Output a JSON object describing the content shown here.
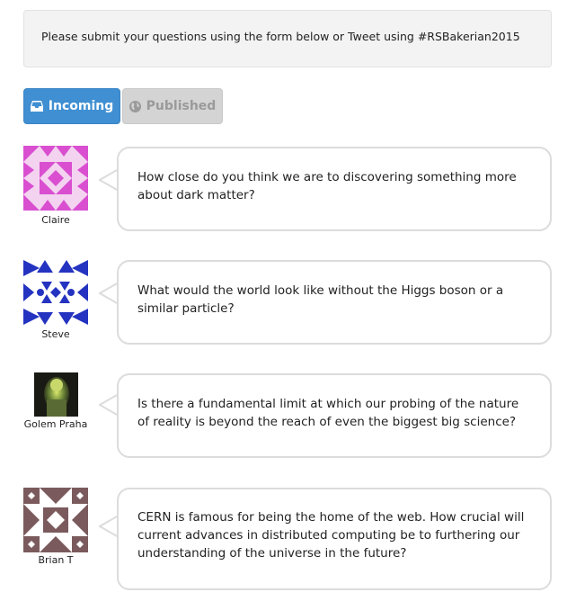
{
  "notice": {
    "text": "Please submit your questions using the form below or Tweet using #RSBakerian2015"
  },
  "tabs": [
    {
      "label": "Incoming",
      "icon": "inbox-icon",
      "active": true,
      "color": "#3f8fd2"
    },
    {
      "label": "Published",
      "icon": "globe-icon",
      "active": false,
      "color": "#d4d4d4"
    }
  ],
  "questions": [
    {
      "author": "Claire",
      "avatar": "identicon-magenta",
      "avatar_color": "#d94fd0",
      "text": "How close do you think we are to discovering something more about dark matter?"
    },
    {
      "author": "Steve",
      "avatar": "identicon-blue",
      "avatar_color": "#2433c0",
      "text": "What would the world look like without the Higgs boson or a similar particle?"
    },
    {
      "author": "Golem Praha",
      "avatar": "photo-golem",
      "text": "Is there a fundamental limit at which our probing of the nature of reality is beyond the reach of even the biggest big science?"
    },
    {
      "author": "Brian T",
      "avatar": "identicon-brown",
      "avatar_color": "#7b5a5d",
      "text": "CERN is famous for being the home of the web. How crucial will current advances in distributed computing be to furthering our understanding of the universe in the future?"
    }
  ]
}
